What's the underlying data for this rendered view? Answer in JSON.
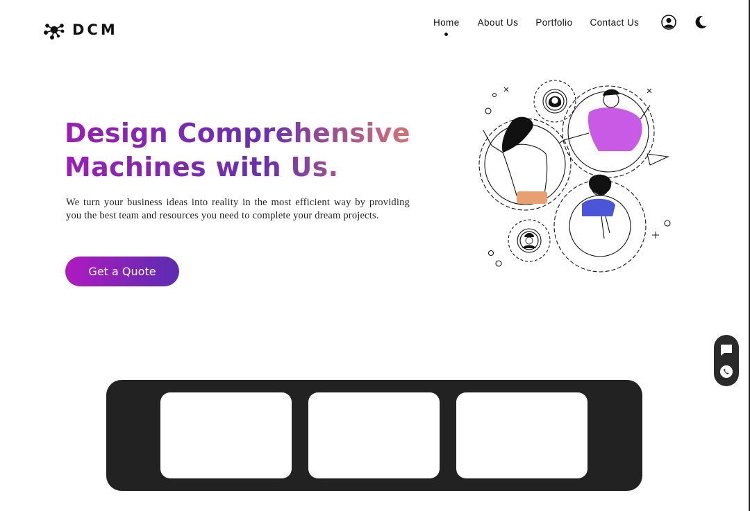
{
  "header": {
    "logo_text": "DCM",
    "logo_icon": "molecule-icon",
    "nav": [
      {
        "label": "Home",
        "active": true
      },
      {
        "label": "About Us",
        "active": false
      },
      {
        "label": "Portfolio",
        "active": false
      },
      {
        "label": "Contact Us",
        "active": false
      }
    ],
    "user_icon": "user-circle-icon",
    "theme_icon": "moon-icon"
  },
  "hero": {
    "title_line1": "Design Comprehensive",
    "title_line2": "Machines with Us.",
    "description": "We turn your business ideas into reality in the most efficient way by providing you the best team and resources you need to complete your dream projects.",
    "cta_label": "Get a Quote",
    "illustration": "team-gears-illustration"
  },
  "floating_actions": {
    "chat_icon": "chat-bubble-icon",
    "phone_icon": "whatsapp-icon"
  },
  "cards": [
    {
      "id": "card-1"
    },
    {
      "id": "card-2"
    },
    {
      "id": "card-3"
    }
  ],
  "colors": {
    "gradient_start": "#9a1fb8",
    "gradient_mid": "#6a2fb0",
    "gradient_end": "#e07a6a",
    "button_start": "#b01ac0",
    "button_end": "#5a2db0",
    "band": "#222222",
    "illus_purple": "#c95ae6",
    "illus_orange": "#e8a070",
    "illus_blue": "#4a55d8"
  }
}
